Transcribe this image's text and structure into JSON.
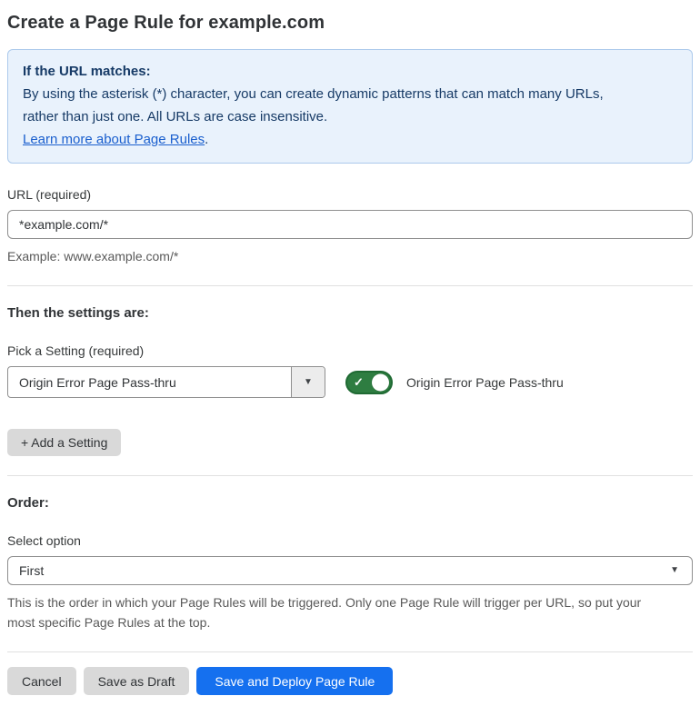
{
  "page": {
    "title": "Create a Page Rule for example.com"
  },
  "info_box": {
    "heading": "If the URL matches:",
    "body_lines": [
      "By using the asterisk (*) character, you can create dynamic patterns that can match many URLs,",
      "rather than just one. All URLs are case insensitive."
    ],
    "link_label": "Learn more about Page Rules",
    "link_suffix": "."
  },
  "url_field": {
    "label": "URL (required)",
    "value": "*example.com/*",
    "helper": "Example: www.example.com/*"
  },
  "settings": {
    "heading": "Then the settings are:",
    "picker_label": "Pick a Setting (required)",
    "picker_value": "Origin Error Page Pass-thru",
    "toggle_state": "on",
    "toggle_label": "Origin Error Page Pass-thru",
    "add_button_label": "+ Add a Setting"
  },
  "order": {
    "heading": "Order:",
    "select_label": "Select option",
    "select_value": "First",
    "helper_lines": [
      "This is the order in which your Page Rules will be triggered. Only one Page Rule will trigger per URL, so put your",
      "most specific Page Rules at the top."
    ]
  },
  "footer": {
    "cancel_label": "Cancel",
    "save_draft_label": "Save as Draft",
    "save_deploy_label": "Save and Deploy Page Rule"
  },
  "icons": {
    "caret_down": "▼",
    "check": "✓"
  },
  "colors": {
    "primary_blue": "#1570ef",
    "toggle_green": "#2e7d41",
    "toggle_green_border": "#1f6a33",
    "info_bg": "#e9f2fc",
    "info_border": "#accaec",
    "info_text": "#163a66",
    "link_blue": "#1a5fce"
  }
}
